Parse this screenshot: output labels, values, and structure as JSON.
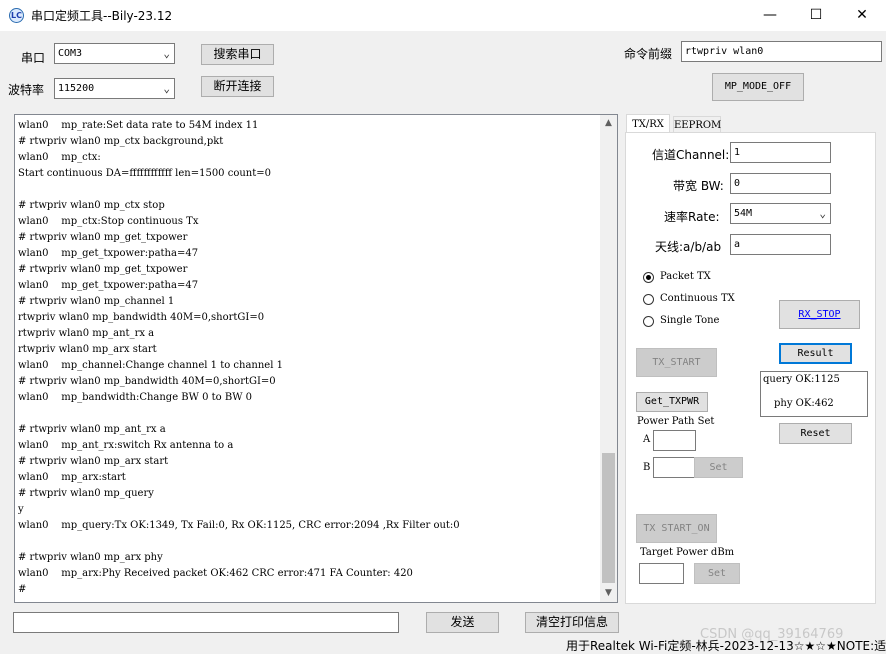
{
  "window": {
    "title": "串口定频工具--Bily-23.12",
    "icon_text": "LC",
    "minimize": "—",
    "maximize": "☐",
    "close": "✕"
  },
  "serial": {
    "port_label": "串口",
    "port_value": "COM3",
    "search_button": "搜索串口",
    "baud_label": "波特率",
    "baud_value": "115200",
    "connect_button": "断开连接"
  },
  "command": {
    "prefix_label": "命令前缀",
    "prefix_value": "rtwpriv wlan0",
    "mode_button": "MP_MODE_OFF"
  },
  "log": {
    "lines": [
      "wlan0    mp_rate:Set data rate to 54M index 11",
      "# rtwpriv wlan0 mp_ctx background,pkt",
      "wlan0    mp_ctx:",
      "Start continuous DA=ffffffffffff len=1500 count=0",
      "",
      "# rtwpriv wlan0 mp_ctx stop",
      "wlan0    mp_ctx:Stop continuous Tx",
      "# rtwpriv wlan0 mp_get_txpower",
      "wlan0    mp_get_txpower:patha=47",
      "# rtwpriv wlan0 mp_get_txpower",
      "wlan0    mp_get_txpower:patha=47",
      "# rtwpriv wlan0 mp_channel 1",
      "rtwpriv wlan0 mp_bandwidth 40M=0,shortGI=0",
      "rtwpriv wlan0 mp_ant_rx a",
      "rtwpriv wlan0 mp_arx start",
      "wlan0    mp_channel:Change channel 1 to channel 1",
      "# rtwpriv wlan0 mp_bandwidth 40M=0,shortGI=0",
      "wlan0    mp_bandwidth:Change BW 0 to BW 0",
      "",
      "# rtwpriv wlan0 mp_ant_rx a",
      "wlan0    mp_ant_rx:switch Rx antenna to a",
      "# rtwpriv wlan0 mp_arx start",
      "wlan0    mp_arx:start",
      "# rtwpriv wlan0 mp_query",
      "y",
      "wlan0    mp_query:Tx OK:1349, Tx Fail:0, Rx OK:1125, CRC error:2094 ,Rx Filter out:0",
      "",
      "# rtwpriv wlan0 mp_arx phy",
      "wlan0    mp_arx:Phy Received packet OK:462 CRC error:471 FA Counter: 420",
      "#"
    ],
    "scroll_up": "▲",
    "scroll_down": "▼"
  },
  "tabs": {
    "txrx": "TX/RX",
    "eeprom": "EEPROM"
  },
  "settings": {
    "channel_label": "信道Channel:",
    "channel_value": "1",
    "bw_label": "带宽 BW:",
    "bw_value": "0",
    "rate_label": "速率Rate:",
    "rate_value": "54M",
    "antenna_label": "天线:a/b/ab",
    "antenna_value": "a"
  },
  "tx_mode": {
    "packet_tx": "Packet TX",
    "continuous_tx": "Continuous TX",
    "single_tone": "Single Tone",
    "selected": "packet_tx"
  },
  "buttons": {
    "rx_stop": "RX_STOP",
    "result": "Result",
    "tx_start": "TX_START",
    "get_txpwr": "Get_TXPWR",
    "reset": "Reset",
    "tx_start_on": "TX START_ON",
    "set1": "Set",
    "set2": "Set"
  },
  "result": {
    "query_ok": "query OK:1125",
    "phy_ok": "phy OK:462"
  },
  "power": {
    "path_set_label": "Power Path Set",
    "a_label": "A",
    "a_value": "",
    "b_label": "B",
    "b_value": "",
    "target_label": "Target Power dBm",
    "target_value": ""
  },
  "bottom": {
    "send_input": "",
    "send_button": "发送",
    "clear_button": "清空打印信息",
    "status_text": "用于Realtek Wi-Fi定频-林兵-2023-12-13☆★☆★NOTE:适",
    "watermark": "CSDN @qq_39164769"
  },
  "colors": {
    "focus_blue": "#0078d7",
    "link_blue": "#0000ff"
  }
}
